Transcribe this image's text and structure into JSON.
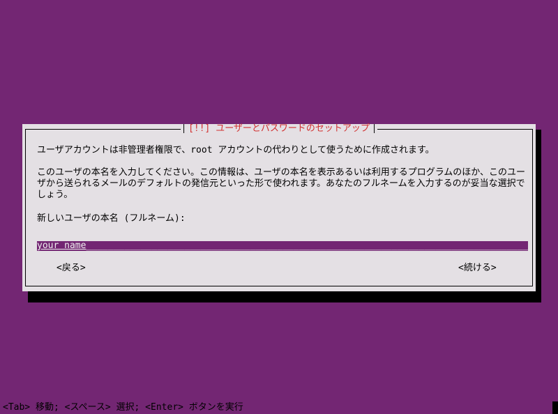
{
  "dialog": {
    "title": "[!!] ユーザーとパスワードのセットアップ",
    "intro": "ユーザアカウントは非管理者権限で、root アカウントの代わりとして使うために作成されます。",
    "description": "このユーザの本名を入力してください。この情報は、ユーザの本名を表示あるいは利用するプログラムのほか、このユーザから送られるメールのデフォルトの発信元といった形で使われます。あなたのフルネームを入力するのが妥当な選択でしょう。",
    "prompt": "新しいユーザの本名 (フルネーム):",
    "input": {
      "value": "your name",
      "filler": "_________________________________________________________________________________________"
    },
    "back_button": "<戻る>",
    "continue_button": "<続ける>"
  },
  "status_bar": {
    "text": "<Tab> 移動; <スペース> 選択; <Enter> ボタンを実行"
  },
  "colors": {
    "background": "#732673",
    "dialog_bg": "#e4e0e4",
    "title_color": "#d23030",
    "input_bg": "#732673",
    "input_text": "#f0f0f0"
  }
}
